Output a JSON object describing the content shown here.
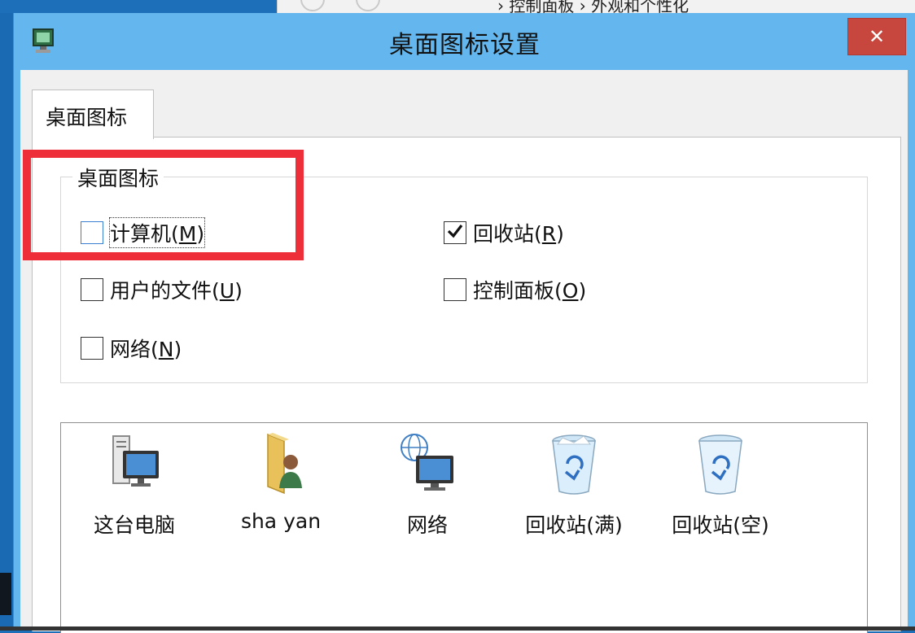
{
  "background": {
    "breadcrumb_sep": "›",
    "breadcrumb_1": "控制面板",
    "breadcrumb_2": "外观和个性化"
  },
  "dialog": {
    "title": "桌面图标设置",
    "close_label": "✕",
    "tab_label": "桌面图标",
    "group_title": "桌面图标",
    "checkboxes": [
      {
        "label": "计算机",
        "mnemonic": "M",
        "checked": false
      },
      {
        "label": "回收站",
        "mnemonic": "R",
        "checked": true
      },
      {
        "label": "用户的文件",
        "mnemonic": "U",
        "checked": false
      },
      {
        "label": "控制面板",
        "mnemonic": "O",
        "checked": false
      },
      {
        "label": "网络",
        "mnemonic": "N",
        "checked": false
      }
    ],
    "icons": [
      {
        "label": "这台电脑",
        "icon": "computer-icon"
      },
      {
        "label": "sha yan",
        "icon": "user-folder-icon"
      },
      {
        "label": "网络",
        "icon": "network-icon"
      },
      {
        "label": "回收站(满)",
        "icon": "recycle-bin-full-icon"
      },
      {
        "label": "回收站(空)",
        "icon": "recycle-bin-empty-icon"
      }
    ]
  },
  "colors": {
    "titlebar": "#63b7ee",
    "close_button": "#c7463d",
    "highlight": "#ee2f39",
    "desktop": "#1c6fb8"
  }
}
